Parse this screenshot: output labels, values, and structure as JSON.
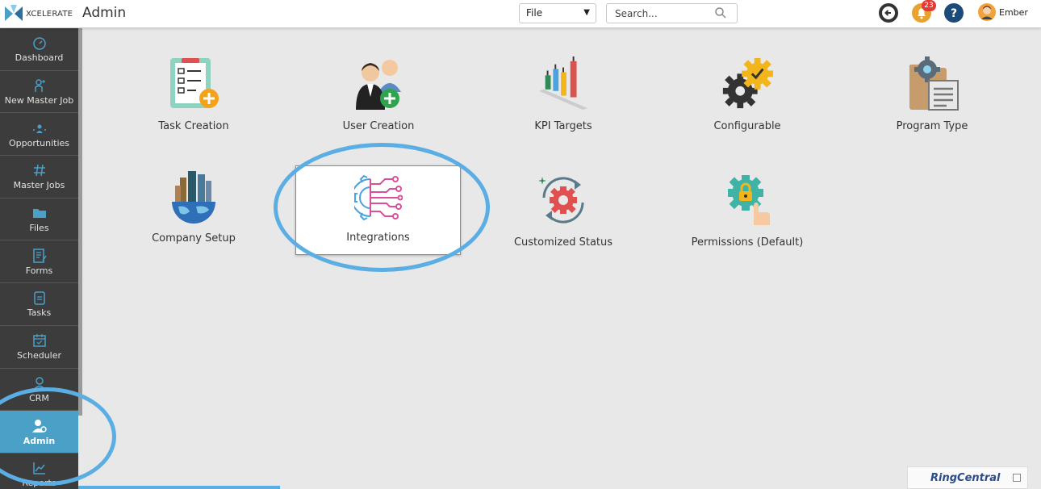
{
  "app": {
    "logo_text": "XCELERATE",
    "page_title": "Admin"
  },
  "header": {
    "file_select_value": "File",
    "search_placeholder": "Search...",
    "notification_count": "23",
    "user_name": "Ember"
  },
  "sidebar": {
    "items": [
      {
        "label": "Dashboard",
        "icon": "dashboard-gauge-icon"
      },
      {
        "label": "New Master Job",
        "icon": "new-job-person-icon"
      },
      {
        "label": "Opportunities",
        "icon": "opportunities-icon"
      },
      {
        "label": "Master Jobs",
        "icon": "hashtag-icon"
      },
      {
        "label": "Files",
        "icon": "folder-icon"
      },
      {
        "label": "Forms",
        "icon": "form-icon"
      },
      {
        "label": "Tasks",
        "icon": "task-icon"
      },
      {
        "label": "Scheduler",
        "icon": "calendar-icon"
      },
      {
        "label": "CRM",
        "icon": "crm-icon"
      },
      {
        "label": "Admin",
        "icon": "admin-icon"
      },
      {
        "label": "Reports",
        "icon": "reports-chart-icon"
      }
    ],
    "active_item": "Admin"
  },
  "admin_tiles": [
    {
      "label": "Task Creation"
    },
    {
      "label": "User Creation"
    },
    {
      "label": "KPI Targets"
    },
    {
      "label": "Configurable"
    },
    {
      "label": "Program Type"
    },
    {
      "label": "Company Setup"
    },
    {
      "label": "Integrations"
    },
    {
      "label": "Customized Status"
    },
    {
      "label": "Permissions (Default)"
    }
  ],
  "widget": {
    "brand": "RingCentral"
  },
  "colors": {
    "sidebar_bg": "#3c3c3c",
    "active_item": "#4ba0c8",
    "annotation": "#5aaee3",
    "background": "#e8e8e8"
  }
}
